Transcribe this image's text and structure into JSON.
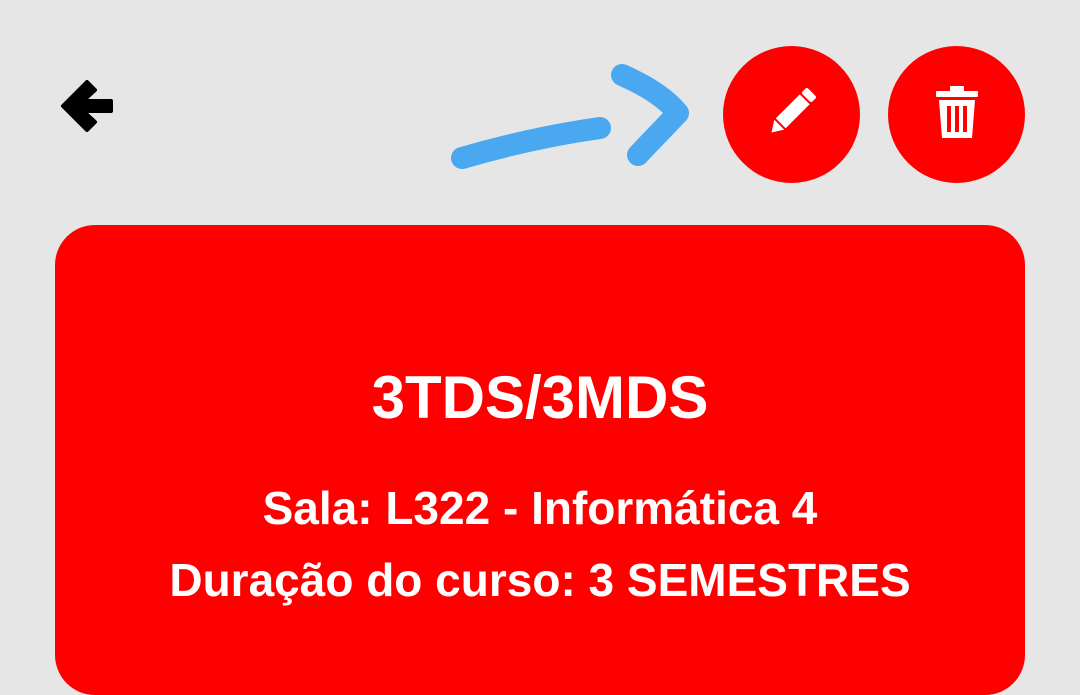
{
  "colors": {
    "background": "#e6e6e6",
    "accent": "#ff0000",
    "annotation": "#4aa8f0",
    "icon_dark": "#000000",
    "on_accent": "#ffffff"
  },
  "toolbar": {
    "back_icon": "arrow-left-icon",
    "edit_icon": "pencil-icon",
    "delete_icon": "trash-icon",
    "annotation_icon": "hand-drawn-arrow"
  },
  "course": {
    "title": "3TDS/3MDS",
    "room": "Sala: L322 - Informática 4",
    "duration": "Duração do curso: 3 SEMESTRES"
  }
}
